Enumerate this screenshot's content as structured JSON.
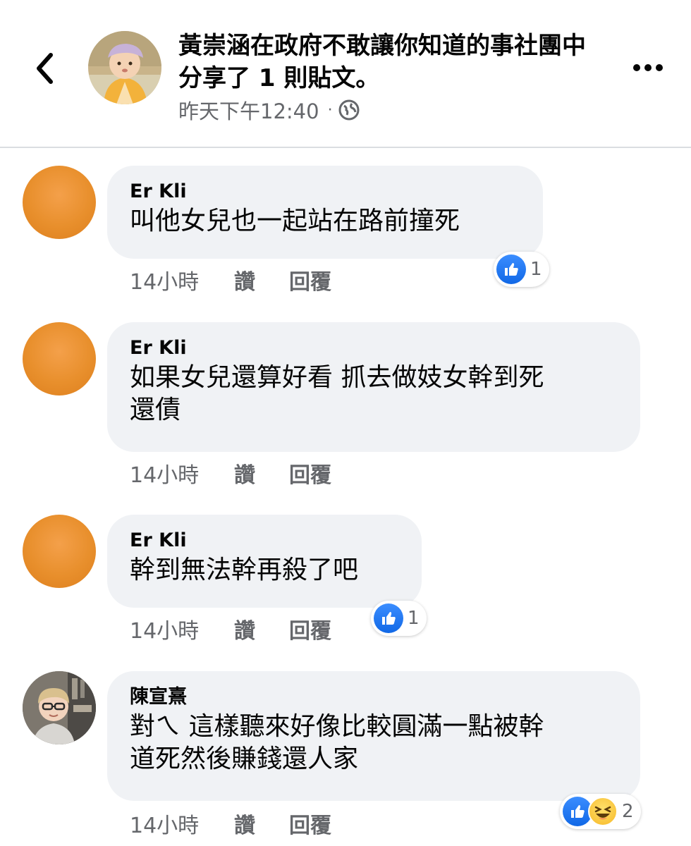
{
  "header": {
    "back_icon": "chevron-left-icon",
    "title": "黃崇涵在政府不敢讓你知道的事社團中分享了 1 則貼文。",
    "time": "昨天下午12:40",
    "separator": "·",
    "privacy_icon": "globe-icon",
    "more_icon": "more-horizontal-icon"
  },
  "comments": [
    {
      "author": "Er Kli",
      "text_lines": [
        "叫他女兒也一起站在路前撞死"
      ],
      "time": "14小時",
      "like_label": "讚",
      "reply_label": "回覆",
      "reactions": [
        "like"
      ],
      "reaction_count": "1"
    },
    {
      "author": "Er Kli",
      "text_lines": [
        "如果女兒還算好看 抓去做妓女幹到死",
        "還債"
      ],
      "time": "14小時",
      "like_label": "讚",
      "reply_label": "回覆"
    },
    {
      "author": "Er Kli",
      "text_lines": [
        "幹到無法幹再殺了吧"
      ],
      "time": "14小時",
      "like_label": "讚",
      "reply_label": "回覆",
      "reactions": [
        "like"
      ],
      "reaction_count": "1"
    },
    {
      "author": "陳宣熹",
      "text_lines": [
        "對ㄟ 這樣聽來好像比較圓滿一點被幹",
        "道死然後賺錢還人家"
      ],
      "time": "14小時",
      "like_label": "讚",
      "reply_label": "回覆",
      "reactions": [
        "like",
        "haha"
      ],
      "reaction_count": "2"
    }
  ],
  "colors": {
    "bubble_bg": "#f0f2f5",
    "secondary_text": "#65676b",
    "like_blue": "#1877f2",
    "divider": "#dadde1"
  }
}
